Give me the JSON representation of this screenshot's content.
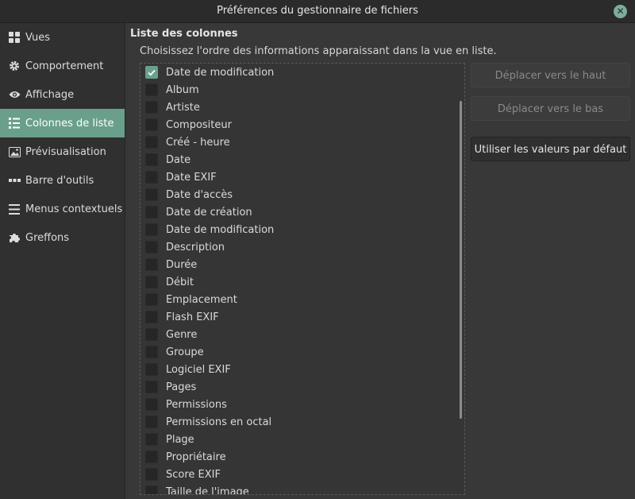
{
  "window": {
    "title": "Préférences du gestionnaire de fichiers",
    "close_icon": "close-icon"
  },
  "sidebar": {
    "items": [
      {
        "label": "Vues",
        "icon": "grid-icon"
      },
      {
        "label": "Comportement",
        "icon": "gear-icon"
      },
      {
        "label": "Affichage",
        "icon": "eye-icon"
      },
      {
        "label": "Colonnes de liste",
        "icon": "list-icon"
      },
      {
        "label": "Prévisualisation",
        "icon": "image-icon"
      },
      {
        "label": "Barre d'outils",
        "icon": "dots-icon"
      },
      {
        "label": "Menus contextuels",
        "icon": "menu-icon"
      },
      {
        "label": "Greffons",
        "icon": "puzzle-icon"
      }
    ],
    "active_index": 3,
    "accent_color": "#6a9f8c"
  },
  "main": {
    "section_title": "Liste des colonnes",
    "section_desc": "Choisissez l'ordre des informations apparaissant dans la vue en liste.",
    "columns": [
      {
        "label": "Date de modification",
        "checked": true
      },
      {
        "label": "Album",
        "checked": false
      },
      {
        "label": "Artiste",
        "checked": false
      },
      {
        "label": "Compositeur",
        "checked": false
      },
      {
        "label": "Créé - heure",
        "checked": false
      },
      {
        "label": "Date",
        "checked": false
      },
      {
        "label": "Date EXIF",
        "checked": false
      },
      {
        "label": "Date d'accès",
        "checked": false
      },
      {
        "label": "Date de création",
        "checked": false
      },
      {
        "label": "Date de modification",
        "checked": false
      },
      {
        "label": "Description",
        "checked": false
      },
      {
        "label": "Durée",
        "checked": false
      },
      {
        "label": "Débit",
        "checked": false
      },
      {
        "label": "Emplacement",
        "checked": false
      },
      {
        "label": "Flash EXIF",
        "checked": false
      },
      {
        "label": "Genre",
        "checked": false
      },
      {
        "label": "Groupe",
        "checked": false
      },
      {
        "label": "Logiciel EXIF",
        "checked": false
      },
      {
        "label": "Pages",
        "checked": false
      },
      {
        "label": "Permissions",
        "checked": false
      },
      {
        "label": "Permissions en octal",
        "checked": false
      },
      {
        "label": "Plage",
        "checked": false
      },
      {
        "label": "Propriétaire",
        "checked": false
      },
      {
        "label": "Score EXIF",
        "checked": false
      },
      {
        "label": "Taille de l'image",
        "checked": false
      }
    ],
    "buttons": {
      "move_up": "Déplacer vers le haut",
      "move_down": "Déplacer vers le bas",
      "reset": "Utiliser les valeurs par défaut"
    }
  }
}
